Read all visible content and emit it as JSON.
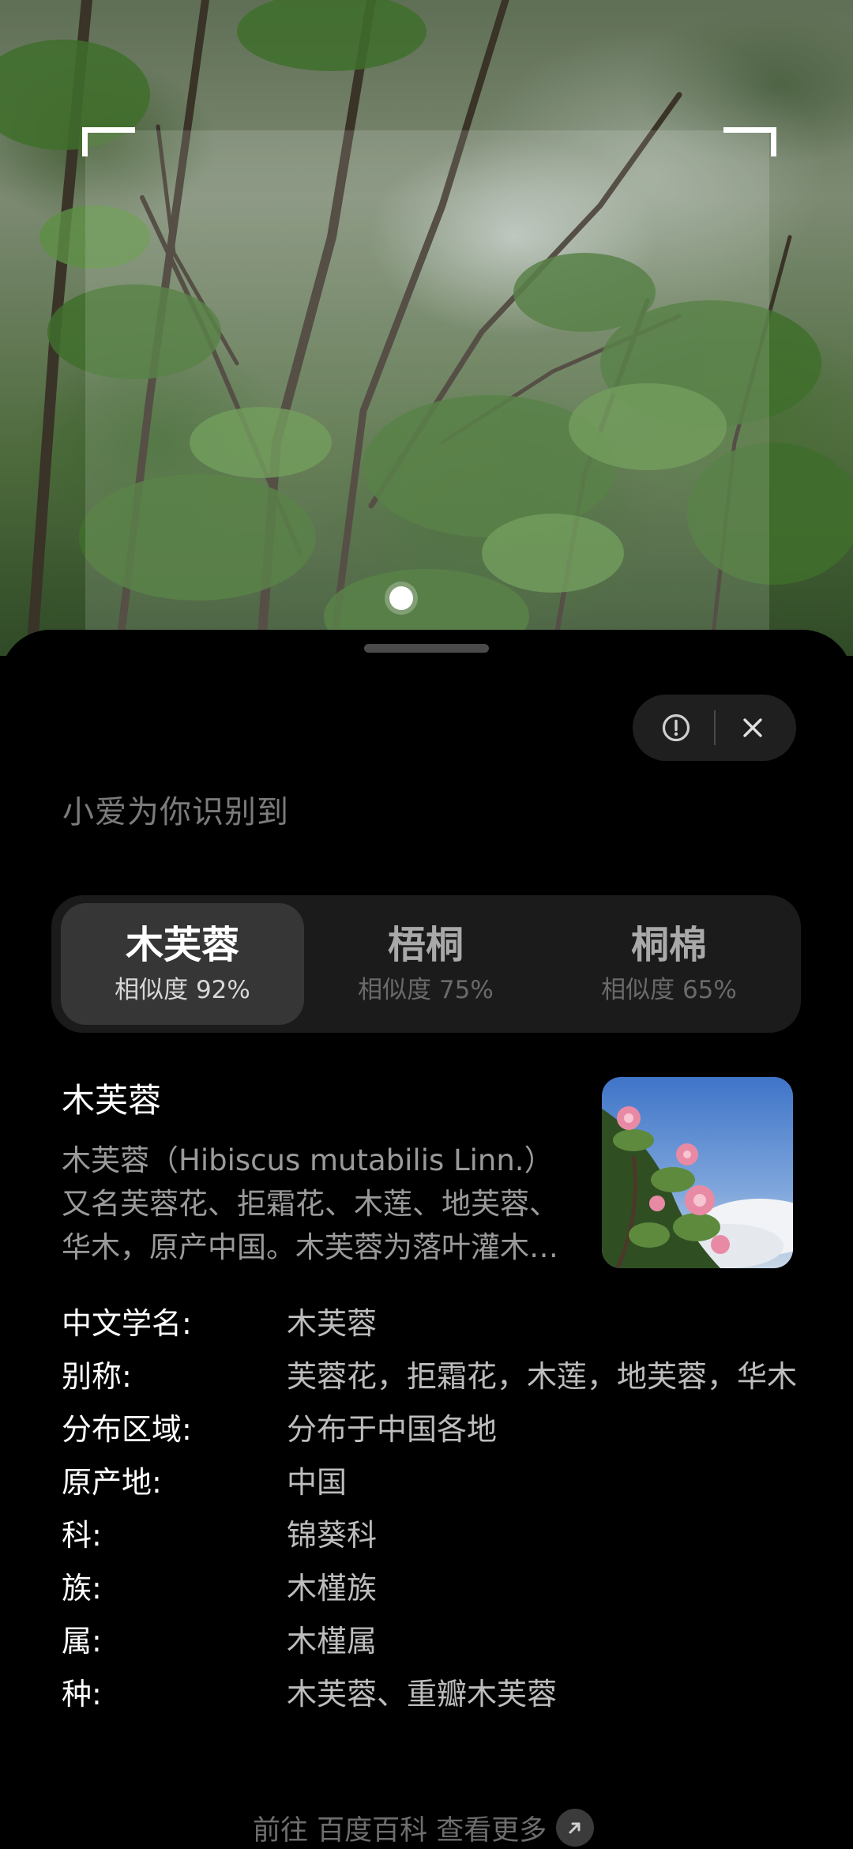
{
  "sheet": {
    "heading": "小爱为你识别到"
  },
  "icons": {
    "report": "exclamation-circle-icon",
    "close": "close-icon",
    "go": "arrow-up-right-icon"
  },
  "tabs": [
    {
      "name": "木芙蓉",
      "similarity": "相似度 92%",
      "active": true
    },
    {
      "name": "梧桐",
      "similarity": "相似度 75%",
      "active": false
    },
    {
      "name": "桐棉",
      "similarity": "相似度 65%",
      "active": false
    }
  ],
  "summary": {
    "title": "木芙蓉",
    "description": "木芙蓉（Hibiscus mutabilis Linn.）又名芙蓉花、拒霜花、木莲、地芙蓉、华木，原产中国。木芙蓉为落叶灌木或小乔木。"
  },
  "info": [
    {
      "key": "中文学名:",
      "value": "木芙蓉"
    },
    {
      "key": "别称:",
      "value": "芙蓉花，拒霜花，木莲，地芙蓉，华木"
    },
    {
      "key": "分布区域:",
      "value": "分布于中国各地"
    },
    {
      "key": "原产地:",
      "value": "中国"
    },
    {
      "key": "科:",
      "value": "锦葵科"
    },
    {
      "key": "族:",
      "value": "木槿族"
    },
    {
      "key": "属:",
      "value": "木槿属"
    },
    {
      "key": "种:",
      "value": "木芙蓉、重瓣木芙蓉"
    }
  ],
  "footer": {
    "more_link": "前往 百度百科 查看更多"
  },
  "colors": {
    "sheet_bg": "#000000",
    "tab_active_bg": "#363636",
    "tab_bar_bg": "#1b1b1b"
  }
}
